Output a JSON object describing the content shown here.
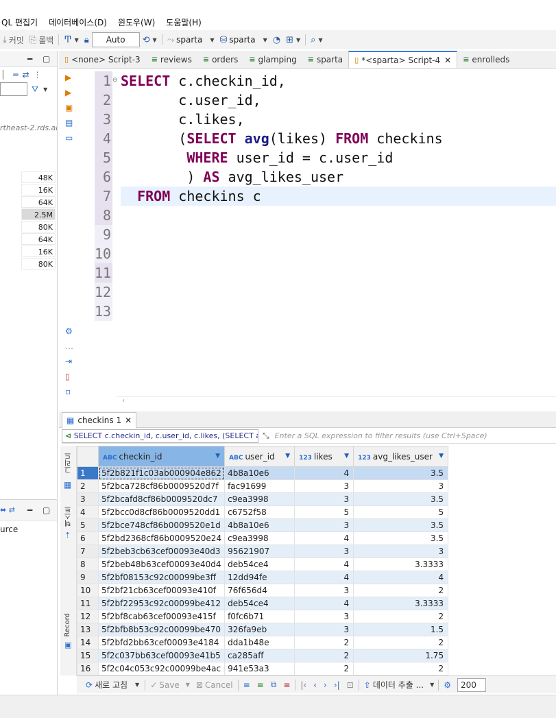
{
  "menu": [
    "QL 편집기",
    "데이터베이스(D)",
    "윈도우(W)",
    "도움말(H)"
  ],
  "toolbar": {
    "commit_label": "커밋",
    "rollback_label": "롤백",
    "transaction_mode": "Auto",
    "connection": "sparta",
    "database": "sparta"
  },
  "left_panel": {
    "host_fragment": "rtheast-2.rds.am",
    "sizes": [
      "48K",
      "16K",
      "64K",
      "2.5M",
      "80K",
      "64K",
      "16K",
      "80K"
    ],
    "highlighted_size_index": 3,
    "bottom_label": "urce"
  },
  "editor_tabs": [
    {
      "label": "<none> Script-3",
      "icon": "script-icon",
      "active": false
    },
    {
      "label": "reviews",
      "icon": "table-icon",
      "active": false
    },
    {
      "label": "orders",
      "icon": "table-icon",
      "active": false
    },
    {
      "label": "glamping",
      "icon": "table-icon",
      "active": false
    },
    {
      "label": "sparta",
      "icon": "table-icon",
      "active": false
    },
    {
      "label": "*<sparta> Script-4",
      "icon": "script-icon",
      "active": true
    },
    {
      "label": "enrolleds",
      "icon": "table-icon",
      "active": false
    }
  ],
  "editor": {
    "line_numbers": [
      "1",
      "2",
      "3",
      "4",
      "5",
      "6",
      "7",
      "8",
      "9",
      "10",
      "11",
      "12",
      "13"
    ],
    "current_line": 7,
    "code_lines": [
      "SELECT c.checkin_id,",
      "       c.user_id,",
      "       c.likes,",
      "       (SELECT avg(likes) FROM checkins",
      "        WHERE user_id = c.user_id",
      "        ) AS avg_likes_user",
      "  FROM checkins c",
      "",
      "",
      "",
      "",
      "",
      ""
    ]
  },
  "results": {
    "tab_label": "checkins 1",
    "sql_preview": "SELECT c.checkin_id, c.user_id, c.likes, (SELECT a",
    "filter_placeholder": "Enter a SQL expression to filter results (use Ctrl+Space)",
    "side_labels": {
      "grid": "그리드",
      "text": "텍스트",
      "record": "Record"
    },
    "columns": [
      {
        "label": "checkin_id",
        "type": "ABC"
      },
      {
        "label": "user_id",
        "type": "ABC"
      },
      {
        "label": "likes",
        "type": "123"
      },
      {
        "label": "avg_likes_user",
        "type": "123"
      }
    ],
    "rows": [
      [
        "1",
        "5f2b821f1c03ab000904e862",
        "4b8a10e6",
        "4",
        "3.5"
      ],
      [
        "2",
        "5f2bca728cf86b0009520d7f",
        "fac91699",
        "3",
        "3"
      ],
      [
        "3",
        "5f2bcafd8cf86b0009520dc7",
        "c9ea3998",
        "3",
        "3.5"
      ],
      [
        "4",
        "5f2bcc0d8cf86b0009520dd1",
        "c6752f58",
        "5",
        "5"
      ],
      [
        "5",
        "5f2bce748cf86b0009520e1d",
        "4b8a10e6",
        "3",
        "3.5"
      ],
      [
        "6",
        "5f2bd2368cf86b0009520e24",
        "c9ea3998",
        "4",
        "3.5"
      ],
      [
        "7",
        "5f2beb3cb63cef00093e40d3",
        "95621907",
        "3",
        "3"
      ],
      [
        "8",
        "5f2beb48b63cef00093e40d4",
        "deb54ce4",
        "4",
        "3.3333"
      ],
      [
        "9",
        "5f2bf08153c92c00099be3ff",
        "12dd94fe",
        "4",
        "4"
      ],
      [
        "10",
        "5f2bf21cb63cef00093e410f",
        "76f656d4",
        "3",
        "2"
      ],
      [
        "11",
        "5f2bf22953c92c00099be412",
        "deb54ce4",
        "4",
        "3.3333"
      ],
      [
        "12",
        "5f2bf8cab63cef00093e415f",
        "f0fc6b71",
        "3",
        "2"
      ],
      [
        "13",
        "5f2bfb8b53c92c00099be470",
        "326fa9eb",
        "3",
        "1.5"
      ],
      [
        "14",
        "5f2bfd2bb63cef00093e4184",
        "dda1b48e",
        "2",
        "2"
      ],
      [
        "15",
        "5f2c037bb63cef00093e41b5",
        "ca285aff",
        "2",
        "1.75"
      ],
      [
        "16",
        "5f2c04c053c92c00099be4ac",
        "941e53a3",
        "2",
        "2"
      ]
    ],
    "selected_row": 0
  },
  "bottom_bar": {
    "refresh_label": "새로 고침",
    "save_label": "Save",
    "cancel_label": "Cancel",
    "export_label": "데이터 추출 ...",
    "fetch_size": "200"
  },
  "colors": {
    "keyword": "#7f0055",
    "function": "#1b1b8a",
    "selection": "#c5daf3",
    "row_alt": "#e4eef9"
  }
}
